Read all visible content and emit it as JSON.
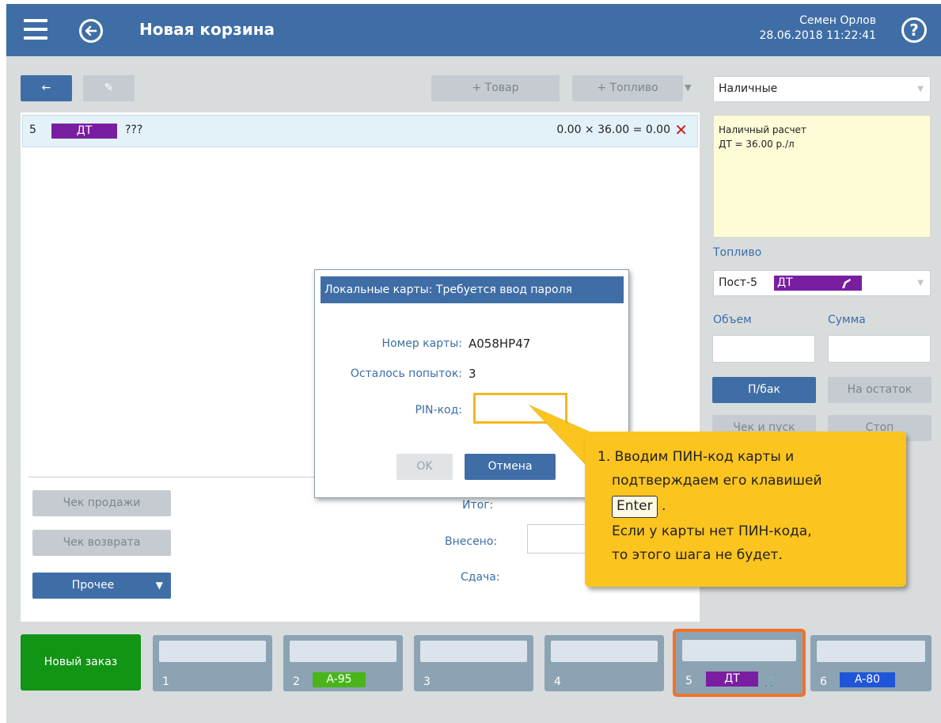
{
  "header": {
    "title": "Новая корзина",
    "user_name": "Семен Орлов",
    "datetime": "28.06.2018 11:22:41",
    "help_label": "?"
  },
  "toolbar": {
    "back_label": "←",
    "edit_label": "✎",
    "add_item_label": "+ Товар",
    "add_fuel_label": "+ Топливо",
    "fuel_caret": "▼"
  },
  "cart_row": {
    "number": "5",
    "fuel": "ДТ",
    "card": "???",
    "calc": "0.00 × 36.00 =",
    "total": "0.00",
    "delete_label": "✕"
  },
  "actions": {
    "sale_receipt": "Чек продажи",
    "return_receipt": "Чек возврата",
    "other": "Прочее",
    "other_caret": "▼"
  },
  "totals": {
    "total_label": "Итог:",
    "paid_label": "Внесено:",
    "change_label": "Сдача:"
  },
  "payment": {
    "method": "Наличные",
    "caret": "▼",
    "note_line1": "Наличный расчет",
    "note_line2": "ДТ = 36.00 р./л"
  },
  "fuel_panel": {
    "section_label": "Топливо",
    "pump": "Пост-5",
    "fuel": "ДТ",
    "caret": "▼",
    "volume_label": "Объем",
    "amount_label": "Сумма",
    "full_tank": "П/бак",
    "remainder": "На остаток",
    "receipt_start": "Чек и пуск",
    "stop": "Стоп"
  },
  "dialog": {
    "title": "Локальные карты: Требуется ввод пароля",
    "card_number_label": "Номер карты:",
    "card_number": "A058HP47",
    "attempts_label": "Осталось попыток:",
    "attempts": "3",
    "pin_label": "PIN-код:",
    "ok_label": "OK",
    "cancel_label": "Отмена"
  },
  "callout": {
    "line1": "1. Вводим ПИН-код карты и",
    "line2": "подтверждаем его клавишей",
    "key": "Enter",
    "line3_suffix": ".",
    "line4": "Если у карты нет ПИН-кода,",
    "line5": "то этого шага не будет."
  },
  "tabs": {
    "new_order": "Новый заказ",
    "items": [
      {
        "n": "1",
        "fuel": ""
      },
      {
        "n": "2",
        "fuel": "A-95"
      },
      {
        "n": "3",
        "fuel": ""
      },
      {
        "n": "4",
        "fuel": ""
      },
      {
        "n": "5",
        "fuel": "ДТ",
        "basket": "🛒"
      },
      {
        "n": "6",
        "fuel": "A-80"
      }
    ]
  },
  "colors": {
    "header": "#3f6ea6",
    "fuel_dt": "#7a1ea1",
    "fuel_a95": "#49b51b",
    "fuel_a80": "#1f56d8",
    "new_order": "#129415",
    "callout": "#fcc41f",
    "active_tab_border": "#f07228"
  }
}
